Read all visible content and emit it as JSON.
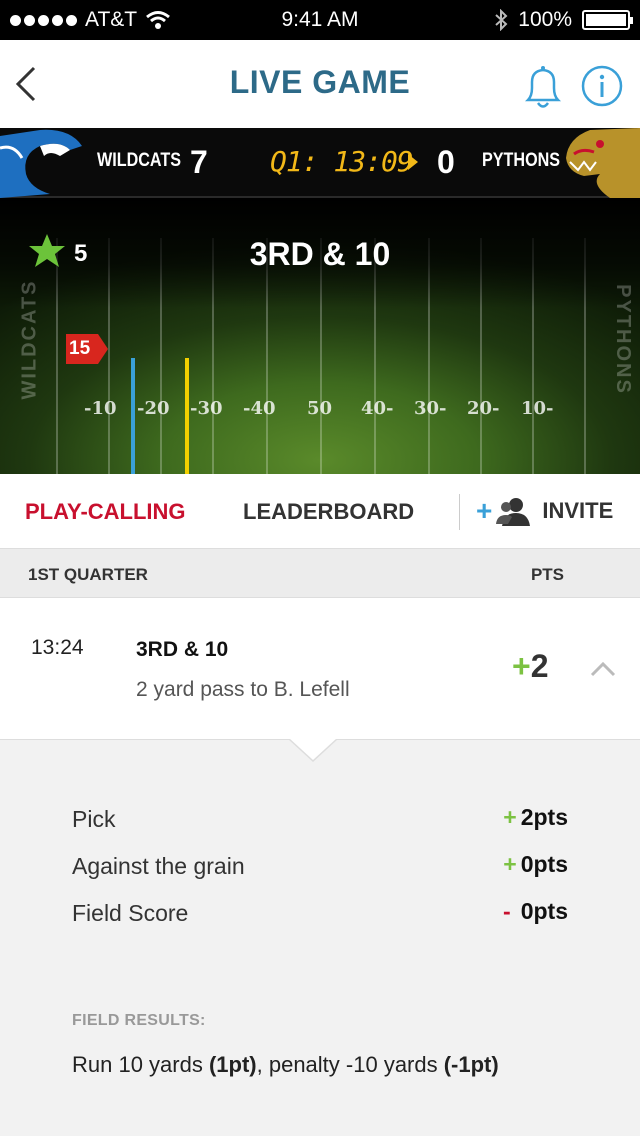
{
  "status_bar": {
    "carrier": "AT&T",
    "time": "9:41 AM",
    "battery": "100%"
  },
  "nav": {
    "title": "LIVE GAME",
    "icons": [
      "back-chevron-icon",
      "bell-icon",
      "info-icon"
    ]
  },
  "scoreboard": {
    "home_team": "WILDCATS",
    "home_score": "7",
    "clock": "Q1: 13:09",
    "away_score": "0",
    "away_team": "PYTHONS"
  },
  "field": {
    "stars": "5",
    "down": "3RD & 10",
    "ball_marker": "15",
    "left_endzone": "WILDCATS",
    "right_endzone": "PYTHONS",
    "yard_numbers": [
      "-10",
      "-20",
      "-30",
      "-40",
      "50",
      "40-",
      "30-",
      "20-",
      "10-"
    ]
  },
  "tabs": {
    "play_calling": "PLAY-CALLING",
    "leaderboard": "LEADERBOARD",
    "invite_plus": "+",
    "invite": "INVITE"
  },
  "section": {
    "title": "1ST QUARTER",
    "pts": "PTS"
  },
  "play": {
    "time": "13:24",
    "down": "3RD & 10",
    "description": "2 yard pass to B. Lefell",
    "points_sign": "+",
    "points": "2"
  },
  "details": [
    {
      "label": "Pick",
      "sign": "+",
      "value": "2pts"
    },
    {
      "label": "Against the grain",
      "sign": "+",
      "value": "0pts"
    },
    {
      "label": "Field Score",
      "sign": "-",
      "value": "0pts"
    }
  ],
  "results": {
    "title": "FIELD RESULTS:",
    "text_a": "Run 10 yards ",
    "text_b": "(1pt)",
    "text_c": ", penalty -10 yards ",
    "text_d": "(-1pt)"
  },
  "colors": {
    "title_blue": "#2d6a88",
    "accent_red": "#c8102e",
    "plus_green": "#7cc242",
    "clock_yellow": "#f2b818",
    "line_blue": "#3aa0d8",
    "line_yellow": "#f2d000"
  }
}
